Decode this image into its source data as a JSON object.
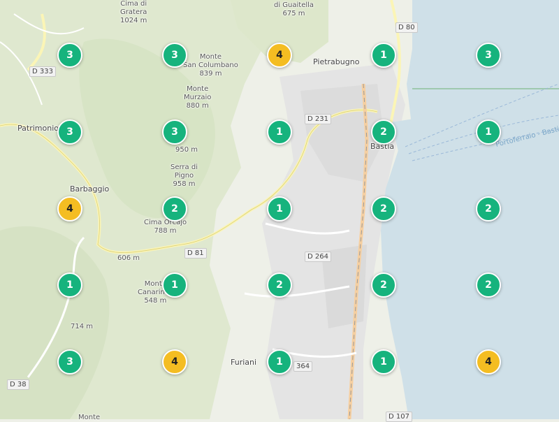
{
  "colors": {
    "sea": "#cfe0e8",
    "land": "#eef0e8",
    "forest": "#dfe8cf",
    "road": "#fbf5b6",
    "cluster_low": "#16b37d",
    "cluster_high": "#f4bd22"
  },
  "peaks": [
    {
      "name": "Cima di\nGratera",
      "elev": "1024 m"
    },
    {
      "name": "di Guaitella",
      "elev": "675 m"
    },
    {
      "name": "Monte\nSan Columbano",
      "elev": "839 m"
    },
    {
      "name": "Monte\nMurzaio",
      "elev": "880 m"
    },
    {
      "name": "",
      "elev": "950 m"
    },
    {
      "name": "Serra di\nPigno",
      "elev": "958 m"
    },
    {
      "name": "Cima Orcajo",
      "elev": "788 m"
    },
    {
      "name": "",
      "elev": "606 m"
    },
    {
      "name": "Monte\nCanarincu",
      "elev": "548 m"
    },
    {
      "name": "",
      "elev": "714 m"
    },
    {
      "name": "Monte",
      "elev": ""
    }
  ],
  "places": [
    "Patrimonio",
    "Barbaggio",
    "Bastia",
    "Furiani",
    "Pietrabugno"
  ],
  "roads": [
    "D 333",
    "D 231",
    "D 81",
    "D 264",
    "D 80",
    "D 38",
    "D 107",
    "364"
  ],
  "ferry_route": "Portoferraio - Bastia",
  "clusters": [
    {
      "count": 3,
      "level": "low"
    },
    {
      "count": 3,
      "level": "low"
    },
    {
      "count": 4,
      "level": "high"
    },
    {
      "count": 1,
      "level": "low"
    },
    {
      "count": 3,
      "level": "low"
    },
    {
      "count": 3,
      "level": "low"
    },
    {
      "count": 3,
      "level": "low"
    },
    {
      "count": 1,
      "level": "low"
    },
    {
      "count": 2,
      "level": "low"
    },
    {
      "count": 1,
      "level": "low"
    },
    {
      "count": 4,
      "level": "high"
    },
    {
      "count": 2,
      "level": "low"
    },
    {
      "count": 1,
      "level": "low"
    },
    {
      "count": 2,
      "level": "low"
    },
    {
      "count": 2,
      "level": "low"
    },
    {
      "count": 1,
      "level": "low"
    },
    {
      "count": 1,
      "level": "low"
    },
    {
      "count": 2,
      "level": "low"
    },
    {
      "count": 2,
      "level": "low"
    },
    {
      "count": 2,
      "level": "low"
    },
    {
      "count": 3,
      "level": "low"
    },
    {
      "count": 4,
      "level": "high"
    },
    {
      "count": 1,
      "level": "low"
    },
    {
      "count": 1,
      "level": "low"
    },
    {
      "count": 4,
      "level": "high"
    }
  ]
}
